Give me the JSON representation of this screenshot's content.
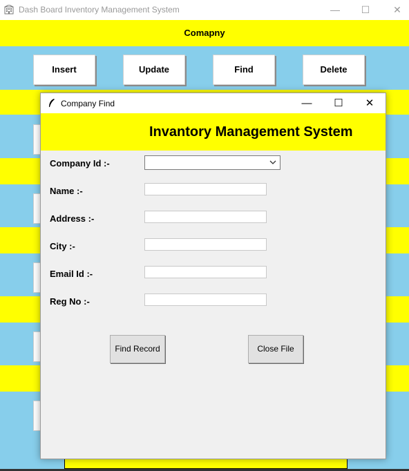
{
  "main_window": {
    "title": "Dash Board Inventory Management System",
    "company_label": "Comapny",
    "buttons": {
      "insert": "Insert",
      "update": "Update",
      "find": "Find",
      "delete": "Delete"
    }
  },
  "dialog": {
    "title": "Company Find",
    "header": "Invantory Management System",
    "fields": {
      "company_id": {
        "label": "Company Id :-",
        "value": ""
      },
      "name": {
        "label": "Name :-",
        "value": ""
      },
      "address": {
        "label": "Address :-",
        "value": ""
      },
      "city": {
        "label": "City :-",
        "value": ""
      },
      "email": {
        "label": "Email Id :-",
        "value": ""
      },
      "reg_no": {
        "label": "Reg No :-",
        "value": ""
      }
    },
    "buttons": {
      "find_record": "Find Record",
      "close_file": "Close File"
    }
  },
  "colors": {
    "background": "#87ceeb",
    "accent": "#ffff00"
  },
  "icons": {
    "app": "building-icon",
    "dialog": "feather-icon"
  }
}
